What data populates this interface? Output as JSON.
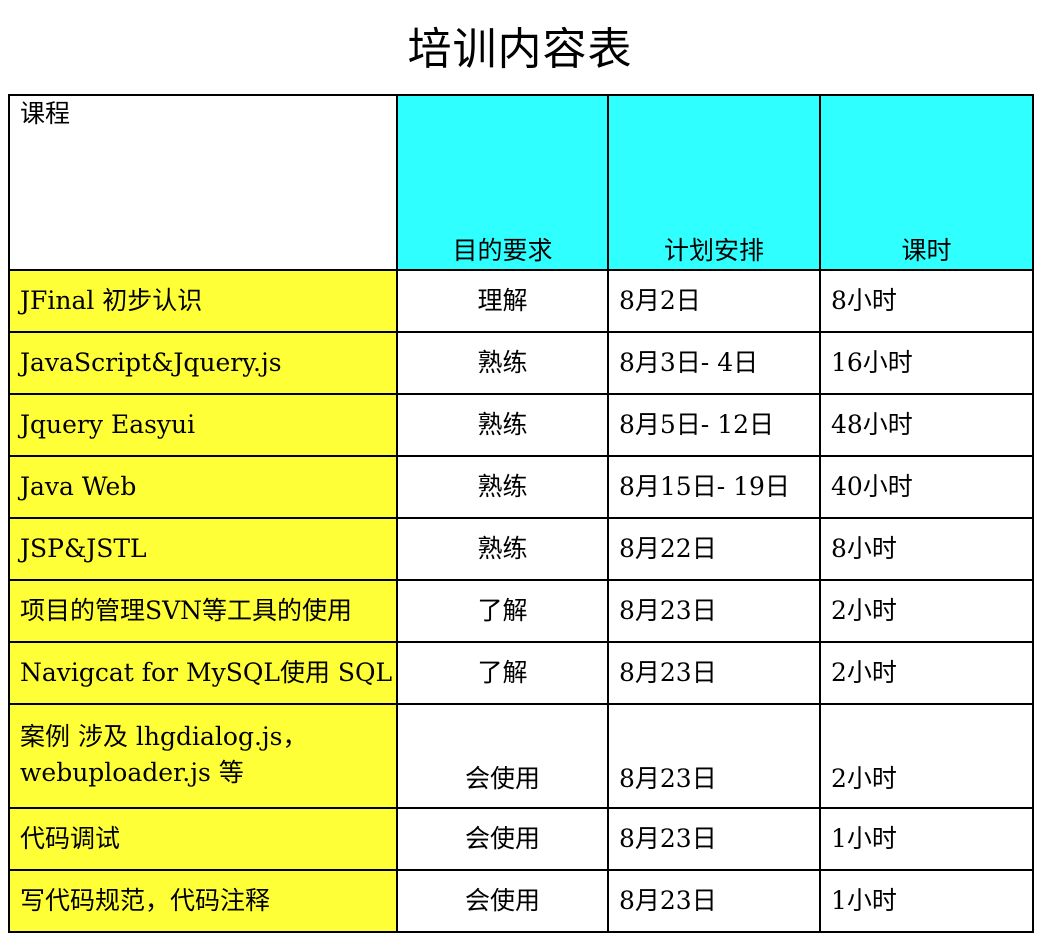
{
  "title": "培训内容表",
  "table": {
    "headers": {
      "course": "课程",
      "goal": "目的要求",
      "plan": "计划安排",
      "hours": "课时"
    },
    "rows": [
      {
        "course": "JFinal 初步认识",
        "goal": "理解",
        "plan": "8月2日",
        "hours": "8小时"
      },
      {
        "course": "JavaScript&Jquery.js",
        "goal": "熟练",
        "plan": "8月3日-  4日",
        "hours": "16小时"
      },
      {
        "course": "Jquery Easyui",
        "goal": "熟练",
        "plan": "8月5日-  12日",
        "hours": "48小时"
      },
      {
        "course": "Java Web",
        "goal": "熟练",
        "plan": "8月15日-  19日",
        "hours": "40小时"
      },
      {
        "course": "JSP&JSTL",
        "goal": "熟练",
        "plan": "8月22日",
        "hours": "8小时"
      },
      {
        "course": "项目的管理SVN等工具的使用",
        "goal": "了解",
        "plan": "8月23日",
        "hours": "2小时"
      },
      {
        "course": "Navigcat for  MySQL使用 SQL",
        "goal": "了解",
        "plan": "8月23日",
        "hours": "2小时"
      },
      {
        "course": "案例 涉及 lhgdialog.js，webuploader.js 等",
        "goal": "会使用",
        "plan": "8月23日",
        "hours": "2小时"
      },
      {
        "course": "代码调试",
        "goal": "会使用",
        "plan": "8月23日",
        "hours": "1小时"
      },
      {
        "course": "写代码规范，代码注释",
        "goal": "会使用",
        "plan": "8月23日",
        "hours": "1小时"
      }
    ]
  },
  "colors": {
    "header_cyan": "#2fffff",
    "course_yellow": "#ffff38",
    "border": "#000000"
  }
}
